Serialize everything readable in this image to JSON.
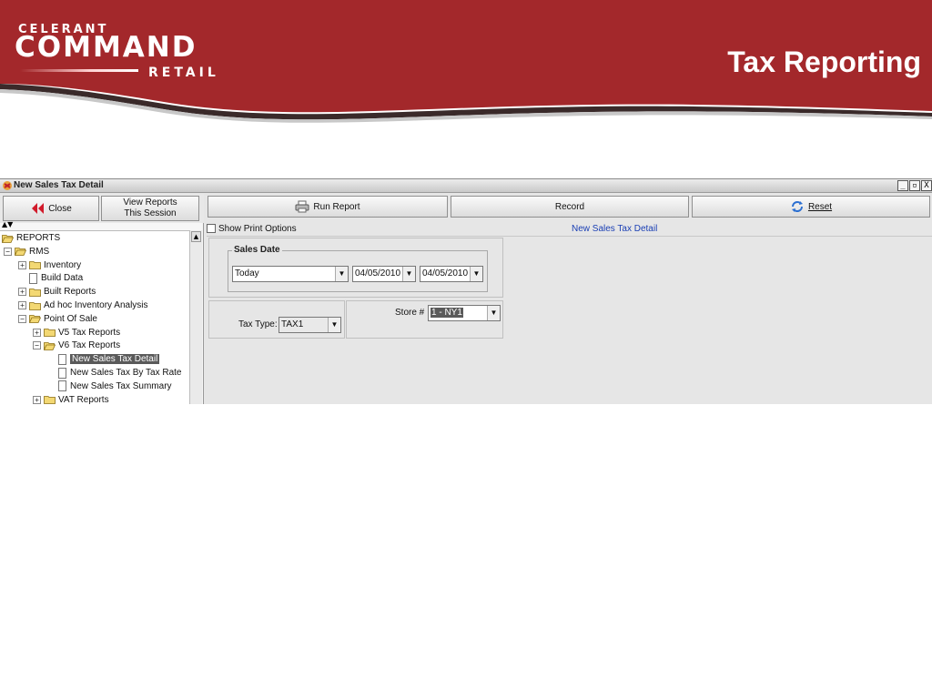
{
  "slide": {
    "logo_top": "CELERANT",
    "logo_main": "COMMAND",
    "logo_bottom": "RETAIL",
    "title": "Tax Reporting"
  },
  "window": {
    "title": "New Sales Tax Detail",
    "controls": [
      "_",
      "▫",
      "X"
    ]
  },
  "left_toolbar": {
    "close_label": "Close",
    "view_line1": "View Reports",
    "view_line2": "This Session"
  },
  "tree": {
    "items": [
      {
        "label": "REPORTS",
        "level": 0,
        "type": "folder-open",
        "expander": ""
      },
      {
        "label": "RMS",
        "level": 1,
        "type": "folder-open",
        "expander": "-"
      },
      {
        "label": "Inventory",
        "level": 2,
        "type": "folder",
        "expander": "+"
      },
      {
        "label": "Build Data",
        "level": 2,
        "type": "doc",
        "expander": ""
      },
      {
        "label": "Built Reports",
        "level": 2,
        "type": "folder",
        "expander": "+"
      },
      {
        "label": "Ad hoc Inventory  Analysis",
        "level": 2,
        "type": "folder",
        "expander": "+"
      },
      {
        "label": "Point Of Sale",
        "level": 2,
        "type": "folder-open",
        "expander": "-"
      },
      {
        "label": "V5 Tax Reports",
        "level": 3,
        "type": "folder",
        "expander": "+"
      },
      {
        "label": "V6 Tax Reports",
        "level": 3,
        "type": "folder-open",
        "expander": "-"
      },
      {
        "label": "New Sales Tax Detail",
        "level": 4,
        "type": "doc",
        "expander": "",
        "selected": true
      },
      {
        "label": "New Sales Tax By Tax Rate",
        "level": 4,
        "type": "doc",
        "expander": ""
      },
      {
        "label": "New Sales Tax Summary",
        "level": 4,
        "type": "doc",
        "expander": ""
      },
      {
        "label": "VAT Reports",
        "level": 3,
        "type": "folder",
        "expander": "+"
      }
    ]
  },
  "main_toolbar": {
    "run_label": "Run Report",
    "record_label": "Record",
    "reset_label": "Reset"
  },
  "print_options_label": "Show Print Options",
  "report_title": "New Sales Tax Detail",
  "sales_date": {
    "legend": "Sales Date",
    "range": "Today",
    "from": "04/05/2010",
    "to": "04/05/2010"
  },
  "tax_type": {
    "label": "Tax Type:",
    "value": "TAX1"
  },
  "store": {
    "label": "Store #",
    "value": "1 - NY1"
  },
  "colors": {
    "banner": "#a3282b",
    "selection": "#5a5a5a",
    "link": "#1a3fb4"
  }
}
